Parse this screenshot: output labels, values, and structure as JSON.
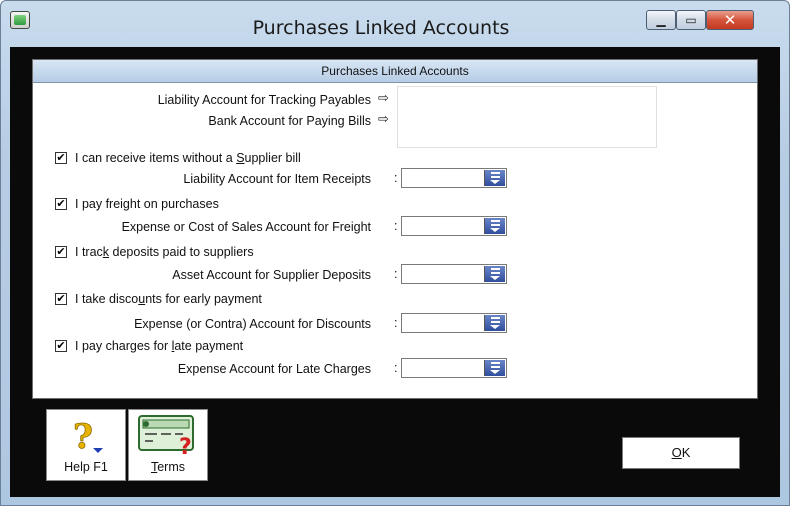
{
  "window": {
    "title": "Purchases Linked Accounts"
  },
  "panel": {
    "header": "Purchases Linked Accounts",
    "liability_tracking_label": "Liability Account for Tracking Payables",
    "bank_paying_label": "Bank Account for Paying Bills",
    "arrow_glyph": "⇨"
  },
  "options": [
    {
      "checked": true,
      "check_label_pre": "I can receive items without a ",
      "check_label_u": "S",
      "check_label_post": "upplier bill",
      "account_label": "Liability Account for Item Receipts"
    },
    {
      "checked": true,
      "check_label_pre": "I pay freight on purchases",
      "check_label_u": "",
      "check_label_post": "",
      "account_label": "Expense or Cost of Sales Account for Freight"
    },
    {
      "checked": true,
      "check_label_pre": "I trac",
      "check_label_u": "k",
      "check_label_post": " deposits paid to suppliers",
      "account_label": "Asset Account for Supplier Deposits"
    },
    {
      "checked": true,
      "check_label_pre": "I take disco",
      "check_label_u": "u",
      "check_label_post": "nts for early payment",
      "account_label": "Expense (or Contra) Account for Discounts"
    },
    {
      "checked": true,
      "check_label_pre": "I pay charges for ",
      "check_label_u": "l",
      "check_label_post": "ate payment",
      "account_label": "Expense Account for Late Charges"
    }
  ],
  "toolbar": {
    "help_label": "Help F1",
    "terms_u": "T",
    "terms_rest": "erms",
    "ok_u": "O",
    "ok_rest": "K"
  },
  "colors": {
    "title_bar": "#b7cde4",
    "client_bg": "#0a0a0a",
    "panel_header": "#c7daee",
    "close_button": "#d6543c"
  },
  "icons": {
    "help": "question-mark-icon",
    "terms": "terms-card-icon",
    "combo": "dropdown-list-icon"
  }
}
